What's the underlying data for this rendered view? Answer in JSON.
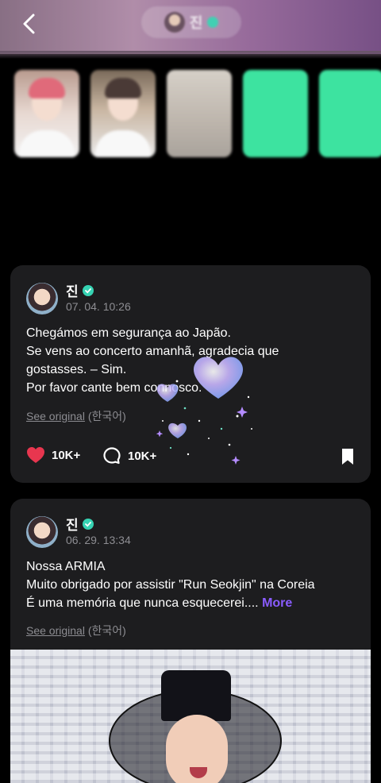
{
  "header": {
    "title": "진",
    "back_icon": "back-chevron-icon"
  },
  "media_strip": {
    "tiles": [
      {
        "type": "photo"
      },
      {
        "type": "photo"
      },
      {
        "type": "photo"
      },
      {
        "type": "text",
        "color": "#3de3a0"
      },
      {
        "type": "text",
        "color": "#3de3a0"
      }
    ]
  },
  "posts": [
    {
      "author": "진",
      "date": "07. 04. 10:26",
      "lines": [
        "Chegámos em segurança ao Japão.",
        "Se vens ao concerto amanhã, agradecia que",
        "gostasses. – Sim.",
        "Por favor cante bem connosco."
      ],
      "see_original": "See original",
      "original_language": "(한국어)",
      "likes": "10K+",
      "comments": "10K+"
    },
    {
      "author": "진",
      "date": "06. 29. 13:34",
      "lines": [
        "Nossa ARMIA",
        "Muito obrigado por assistir \"Run Seokjin\" na Coreia",
        "É uma memória que nunca esquecerei...."
      ],
      "more_label": "More",
      "see_original": "See original",
      "original_language": "(한국어)"
    }
  ],
  "colors": {
    "accent_purple": "#8a5cff",
    "verified_teal": "#36d3b3",
    "like_red": "#e8364f",
    "card_bg": "#1d1d1f"
  }
}
